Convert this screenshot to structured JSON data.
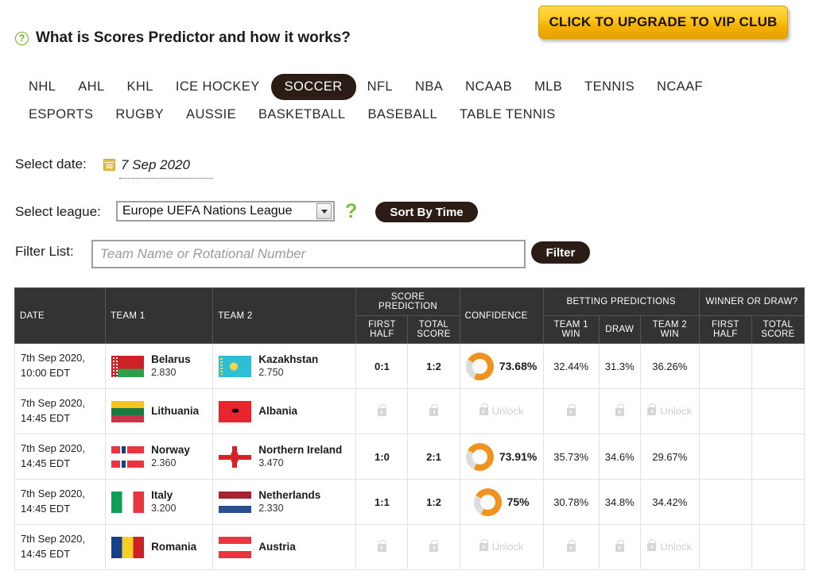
{
  "header": {
    "vip_button": "CLICK TO UPGRADE TO VIP CLUB",
    "help_icon": "question-circle-icon",
    "title": "What is Scores Predictor and how it works?"
  },
  "sport_tabs": {
    "active": "SOCCER",
    "row1": [
      "NHL",
      "AHL",
      "KHL",
      "ICE HOCKEY",
      "SOCCER",
      "NFL",
      "NBA",
      "NCAAB",
      "MLB",
      "TENNIS",
      "NCAAF"
    ],
    "row2": [
      "ESPORTS",
      "RUGBY",
      "AUSSIE",
      "BASKETBALL",
      "BASEBALL",
      "TABLE TENNIS"
    ]
  },
  "controls": {
    "date_label": "Select date:",
    "date_value": "7 Sep 2020",
    "calendar_icon": "calendar-icon",
    "league_label": "Select league:",
    "league_value": "Europe UEFA Nations League",
    "league_help_icon": "question-mark-icon",
    "sort_button": "Sort By Time",
    "filter_label": "Filter List:",
    "filter_placeholder": "Team Name or Rotational Number",
    "filter_value": "",
    "filter_button": "Filter"
  },
  "table": {
    "headers": {
      "date": "DATE",
      "team1": "TEAM 1",
      "team2": "TEAM 2",
      "score_prediction": "SCORE PREDICTION",
      "confidence": "CONFIDENCE",
      "betting_predictions": "BETTING PREDICTIONS",
      "winner_or_draw": "WINNER OR DRAW?",
      "first_half": "FIRST HALF",
      "total_score": "TOTAL SCORE",
      "team1_win": "TEAM 1 WIN",
      "draw": "DRAW",
      "team2_win": "TEAM 2 WIN",
      "wd_first_half": "FIRST HALF",
      "wd_total_score": "TOTAL SCORE"
    },
    "unlock_label": "Unlock",
    "lock_icon": "lock-icon",
    "rows": [
      {
        "locked": false,
        "date_line1": "7th Sep 2020,",
        "date_line2": "10:00 EDT",
        "team1": {
          "name": "Belarus",
          "odds": "2.830",
          "flag": "belarus"
        },
        "team2": {
          "name": "Kazakhstan",
          "odds": "2.750",
          "flag": "kazakhstan"
        },
        "first_half": "0:1",
        "total_score": "1:2",
        "confidence": "73.68%",
        "confidence_value": 73.68,
        "team1_win": "32.44%",
        "draw": "31.3%",
        "team2_win": "36.26%",
        "wd_first_half": "",
        "wd_total_score": ""
      },
      {
        "locked": true,
        "date_line1": "7th Sep 2020,",
        "date_line2": "14:45 EDT",
        "team1": {
          "name": "Lithuania",
          "odds": "",
          "flag": "lithuania"
        },
        "team2": {
          "name": "Albania",
          "odds": "",
          "flag": "albania"
        },
        "first_half": "",
        "total_score": "",
        "confidence": "",
        "confidence_value": 0,
        "team1_win": "",
        "draw": "",
        "team2_win": "",
        "wd_first_half": "",
        "wd_total_score": ""
      },
      {
        "locked": false,
        "date_line1": "7th Sep 2020,",
        "date_line2": "14:45 EDT",
        "team1": {
          "name": "Norway",
          "odds": "2.360",
          "flag": "norway"
        },
        "team2": {
          "name": "Northern Ireland",
          "odds": "3.470",
          "flag": "nireland"
        },
        "first_half": "1:0",
        "total_score": "2:1",
        "confidence": "73.91%",
        "confidence_value": 73.91,
        "team1_win": "35.73%",
        "draw": "34.6%",
        "team2_win": "29.67%",
        "wd_first_half": "",
        "wd_total_score": ""
      },
      {
        "locked": false,
        "date_line1": "7th Sep 2020,",
        "date_line2": "14:45 EDT",
        "team1": {
          "name": "Italy",
          "odds": "3.200",
          "flag": "italy"
        },
        "team2": {
          "name": "Netherlands",
          "odds": "2.330",
          "flag": "netherlands"
        },
        "first_half": "1:1",
        "total_score": "1:2",
        "confidence": "75%",
        "confidence_value": 75,
        "team1_win": "30.78%",
        "draw": "34.8%",
        "team2_win": "34.42%",
        "wd_first_half": "",
        "wd_total_score": ""
      },
      {
        "locked": true,
        "date_line1": "7th Sep 2020,",
        "date_line2": "14:45 EDT",
        "team1": {
          "name": "Romania",
          "odds": "",
          "flag": "romania"
        },
        "team2": {
          "name": "Austria",
          "odds": "",
          "flag": "austria"
        },
        "first_half": "",
        "total_score": "",
        "confidence": "",
        "confidence_value": 0,
        "team1_win": "",
        "draw": "",
        "team2_win": "",
        "wd_first_half": "",
        "wd_total_score": ""
      }
    ]
  },
  "colors": {
    "accent_orange": "#f0921e",
    "vip_gold": "#ffc81e",
    "tab_active": "#2b1d16",
    "green": "#6ab023",
    "header_bg": "#333333"
  }
}
